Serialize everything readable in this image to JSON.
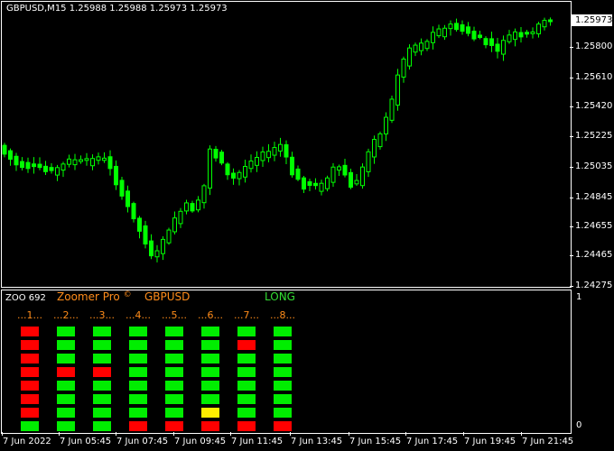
{
  "chart": {
    "symbol_line": "GBPUSD,M15  1.25988 1.25988 1.25973 1.25973",
    "last_price": "1.25973",
    "price_levels": [
      "1.25800",
      "1.25610",
      "1.25420",
      "1.25225",
      "1.25035",
      "1.24845",
      "1.24655",
      "1.24465",
      "1.24275"
    ],
    "candle_color_bull": "#ffffff",
    "candle_color_bear": "#00ff00"
  },
  "indicator": {
    "short_name": "ZOO 692",
    "name": "Zoomer Pro",
    "symbol": "GBPUSD",
    "signal": "LONG",
    "scale_top": "1",
    "scale_bottom": "0",
    "columns": [
      "...1...",
      "...2...",
      "...3...",
      "...4...",
      "...5...",
      "...6...",
      "...7...",
      "...8..."
    ],
    "colors": {
      "up": "#00ee00",
      "down": "#ff0000",
      "neutral": "#ffee00"
    },
    "grid": [
      [
        "down",
        "up",
        "up",
        "up",
        "up",
        "up",
        "up",
        "up"
      ],
      [
        "down",
        "up",
        "up",
        "up",
        "up",
        "up",
        "down",
        "up"
      ],
      [
        "down",
        "up",
        "up",
        "up",
        "up",
        "up",
        "up",
        "up"
      ],
      [
        "down",
        "down",
        "down",
        "up",
        "up",
        "up",
        "up",
        "up"
      ],
      [
        "down",
        "up",
        "up",
        "up",
        "up",
        "up",
        "up",
        "up"
      ],
      [
        "down",
        "up",
        "up",
        "up",
        "up",
        "up",
        "up",
        "up"
      ],
      [
        "down",
        "up",
        "up",
        "up",
        "up",
        "neutral",
        "up",
        "up"
      ],
      [
        "up",
        "up",
        "up",
        "down",
        "down",
        "down",
        "down",
        "down"
      ]
    ]
  },
  "time_axis": [
    "7 Jun 2022",
    "7 Jun 05:45",
    "7 Jun 07:45",
    "7 Jun 09:45",
    "7 Jun 11:45",
    "7 Jun 13:45",
    "7 Jun 15:45",
    "7 Jun 17:45",
    "7 Jun 19:45",
    "7 Jun 21:45"
  ]
}
